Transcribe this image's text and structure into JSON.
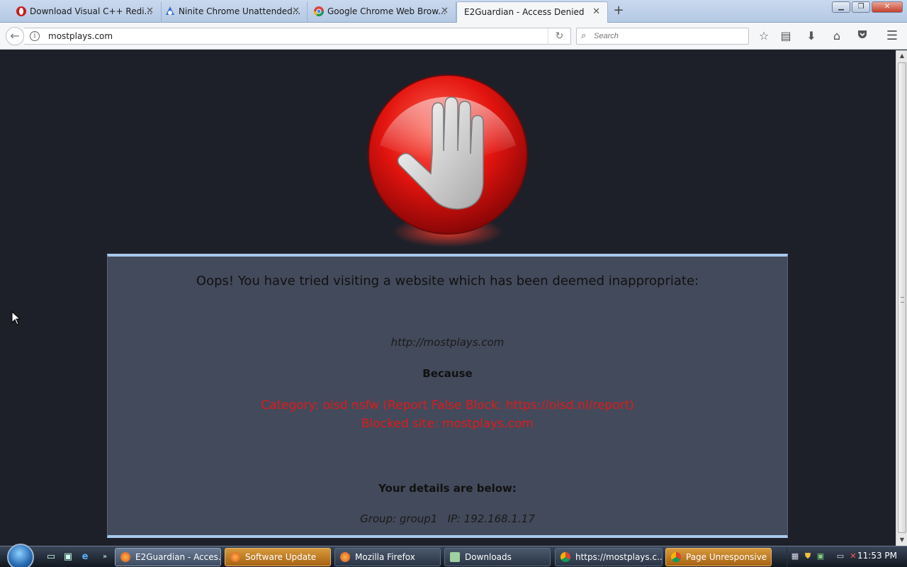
{
  "browser": {
    "tabs": [
      {
        "label": "Download Visual C++ Redi...",
        "icon": "opera-icon",
        "active": false
      },
      {
        "label": "Ninite Chrome Unattended...",
        "icon": "ninite-icon",
        "active": false
      },
      {
        "label": "Google Chrome Web Brow...",
        "icon": "chrome-icon",
        "active": false
      },
      {
        "label": "E2Guardian - Access Denied",
        "icon": "",
        "active": true
      }
    ],
    "url": "mostplays.com",
    "search_placeholder": "Search"
  },
  "page": {
    "headline": "Oops! You have tried visiting a website which has been deemed inappropriate:",
    "blocked_url": "http://mostplays.com",
    "because": "Because",
    "reason_category": "Category: oisd nsfw (Report False Block: https://oisd.nl/report)",
    "reason_site": "Blocked site: mostplays.com",
    "details_heading": "Your details are below:",
    "details": "Group: group1   IP: 192.168.1.17",
    "accent_color": "#a8c8ec",
    "alert_color": "#e01a1a"
  },
  "taskbar": {
    "tasks": [
      {
        "label": "E2Guardian - Acces...",
        "state": "active"
      },
      {
        "label": "Software Update",
        "state": "flash"
      },
      {
        "label": "Mozilla Firefox",
        "state": "normal"
      },
      {
        "label": "Downloads",
        "state": "normal"
      },
      {
        "label": "https://mostplays.c...",
        "state": "normal"
      },
      {
        "label": "Page Unresponsive",
        "state": "flash"
      }
    ],
    "clock": "11:53 PM"
  }
}
